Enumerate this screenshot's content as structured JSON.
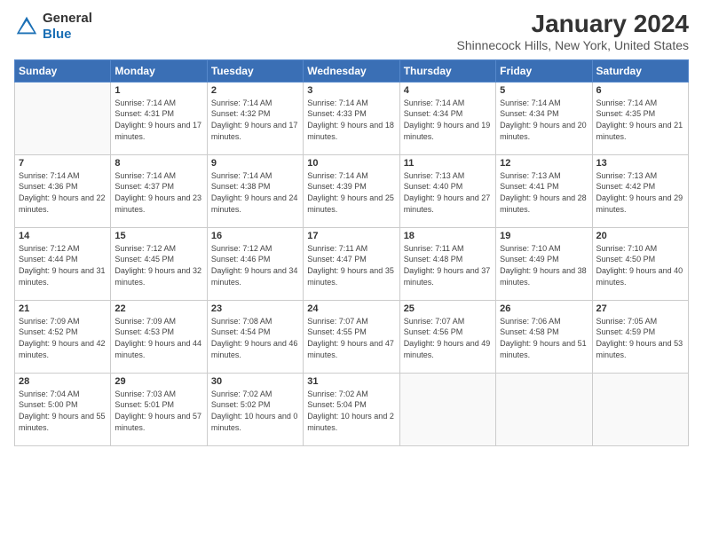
{
  "header": {
    "logo_line1": "General",
    "logo_line2": "Blue",
    "title": "January 2024",
    "subtitle": "Shinnecock Hills, New York, United States"
  },
  "days_of_week": [
    "Sunday",
    "Monday",
    "Tuesday",
    "Wednesday",
    "Thursday",
    "Friday",
    "Saturday"
  ],
  "weeks": [
    [
      {
        "day": "",
        "empty": true
      },
      {
        "day": "1",
        "sunrise": "7:14 AM",
        "sunset": "4:31 PM",
        "daylight": "9 hours and 17 minutes."
      },
      {
        "day": "2",
        "sunrise": "7:14 AM",
        "sunset": "4:32 PM",
        "daylight": "9 hours and 17 minutes."
      },
      {
        "day": "3",
        "sunrise": "7:14 AM",
        "sunset": "4:33 PM",
        "daylight": "9 hours and 18 minutes."
      },
      {
        "day": "4",
        "sunrise": "7:14 AM",
        "sunset": "4:34 PM",
        "daylight": "9 hours and 19 minutes."
      },
      {
        "day": "5",
        "sunrise": "7:14 AM",
        "sunset": "4:34 PM",
        "daylight": "9 hours and 20 minutes."
      },
      {
        "day": "6",
        "sunrise": "7:14 AM",
        "sunset": "4:35 PM",
        "daylight": "9 hours and 21 minutes."
      }
    ],
    [
      {
        "day": "7",
        "sunrise": "7:14 AM",
        "sunset": "4:36 PM",
        "daylight": "9 hours and 22 minutes."
      },
      {
        "day": "8",
        "sunrise": "7:14 AM",
        "sunset": "4:37 PM",
        "daylight": "9 hours and 23 minutes."
      },
      {
        "day": "9",
        "sunrise": "7:14 AM",
        "sunset": "4:38 PM",
        "daylight": "9 hours and 24 minutes."
      },
      {
        "day": "10",
        "sunrise": "7:14 AM",
        "sunset": "4:39 PM",
        "daylight": "9 hours and 25 minutes."
      },
      {
        "day": "11",
        "sunrise": "7:13 AM",
        "sunset": "4:40 PM",
        "daylight": "9 hours and 27 minutes."
      },
      {
        "day": "12",
        "sunrise": "7:13 AM",
        "sunset": "4:41 PM",
        "daylight": "9 hours and 28 minutes."
      },
      {
        "day": "13",
        "sunrise": "7:13 AM",
        "sunset": "4:42 PM",
        "daylight": "9 hours and 29 minutes."
      }
    ],
    [
      {
        "day": "14",
        "sunrise": "7:12 AM",
        "sunset": "4:44 PM",
        "daylight": "9 hours and 31 minutes."
      },
      {
        "day": "15",
        "sunrise": "7:12 AM",
        "sunset": "4:45 PM",
        "daylight": "9 hours and 32 minutes."
      },
      {
        "day": "16",
        "sunrise": "7:12 AM",
        "sunset": "4:46 PM",
        "daylight": "9 hours and 34 minutes."
      },
      {
        "day": "17",
        "sunrise": "7:11 AM",
        "sunset": "4:47 PM",
        "daylight": "9 hours and 35 minutes."
      },
      {
        "day": "18",
        "sunrise": "7:11 AM",
        "sunset": "4:48 PM",
        "daylight": "9 hours and 37 minutes."
      },
      {
        "day": "19",
        "sunrise": "7:10 AM",
        "sunset": "4:49 PM",
        "daylight": "9 hours and 38 minutes."
      },
      {
        "day": "20",
        "sunrise": "7:10 AM",
        "sunset": "4:50 PM",
        "daylight": "9 hours and 40 minutes."
      }
    ],
    [
      {
        "day": "21",
        "sunrise": "7:09 AM",
        "sunset": "4:52 PM",
        "daylight": "9 hours and 42 minutes."
      },
      {
        "day": "22",
        "sunrise": "7:09 AM",
        "sunset": "4:53 PM",
        "daylight": "9 hours and 44 minutes."
      },
      {
        "day": "23",
        "sunrise": "7:08 AM",
        "sunset": "4:54 PM",
        "daylight": "9 hours and 46 minutes."
      },
      {
        "day": "24",
        "sunrise": "7:07 AM",
        "sunset": "4:55 PM",
        "daylight": "9 hours and 47 minutes."
      },
      {
        "day": "25",
        "sunrise": "7:07 AM",
        "sunset": "4:56 PM",
        "daylight": "9 hours and 49 minutes."
      },
      {
        "day": "26",
        "sunrise": "7:06 AM",
        "sunset": "4:58 PM",
        "daylight": "9 hours and 51 minutes."
      },
      {
        "day": "27",
        "sunrise": "7:05 AM",
        "sunset": "4:59 PM",
        "daylight": "9 hours and 53 minutes."
      }
    ],
    [
      {
        "day": "28",
        "sunrise": "7:04 AM",
        "sunset": "5:00 PM",
        "daylight": "9 hours and 55 minutes."
      },
      {
        "day": "29",
        "sunrise": "7:03 AM",
        "sunset": "5:01 PM",
        "daylight": "9 hours and 57 minutes."
      },
      {
        "day": "30",
        "sunrise": "7:02 AM",
        "sunset": "5:02 PM",
        "daylight": "10 hours and 0 minutes."
      },
      {
        "day": "31",
        "sunrise": "7:02 AM",
        "sunset": "5:04 PM",
        "daylight": "10 hours and 2 minutes."
      },
      {
        "day": "",
        "empty": true
      },
      {
        "day": "",
        "empty": true
      },
      {
        "day": "",
        "empty": true
      }
    ]
  ]
}
